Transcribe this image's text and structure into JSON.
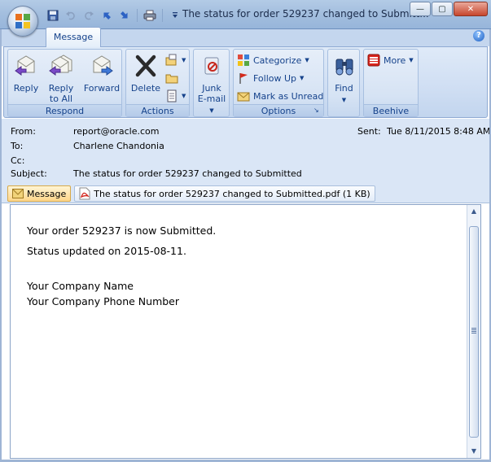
{
  "window": {
    "title": "The status for order 529237 changed to Submitt...",
    "controls": [
      "minimize",
      "maximize",
      "close"
    ]
  },
  "quick_access": [
    "save-icon",
    "undo-icon",
    "redo-icon",
    "previous-item-icon",
    "next-item-icon",
    "print-icon",
    "customize-dropdown-icon"
  ],
  "ribbon": {
    "tab": "Message",
    "groups": {
      "respond": {
        "label": "Respond",
        "reply": "Reply",
        "reply_all_line1": "Reply",
        "reply_all_line2": "to All",
        "forward": "Forward"
      },
      "actions": {
        "label": "Actions",
        "delete": "Delete"
      },
      "junk": {
        "line1": "Junk",
        "line2": "E-mail"
      },
      "options": {
        "label": "Options",
        "categorize": "Categorize",
        "follow_up": "Follow Up",
        "mark_unread": "Mark as Unread"
      },
      "find": {
        "label": "Find"
      },
      "beehive": {
        "label": "Beehive",
        "more": "More"
      }
    }
  },
  "header": {
    "from_label": "From:",
    "from_value": "report@oracle.com",
    "sent_label": "Sent:",
    "sent_value": "Tue 8/11/2015 8:48 AM",
    "to_label": "To:",
    "to_value": "Charlene Chandonia",
    "cc_label": "Cc:",
    "cc_value": "",
    "subject_label": "Subject:",
    "subject_value": "The status for order 529237 changed to Submitted"
  },
  "attachments": {
    "message_tab": "Message",
    "file": "The status for order 529237 changed to Submitted.pdf (1 KB)"
  },
  "body": {
    "line1": "Your order 529237 is now Submitted.",
    "line2": "Status updated on 2015-08-11.",
    "line3": "Your Company Name",
    "line4": "Your Company Phone Number"
  },
  "colors": {
    "ribbon_text": "#15428b",
    "header_bg": "#dae6f6",
    "title_bar": "#a4bfdf"
  }
}
